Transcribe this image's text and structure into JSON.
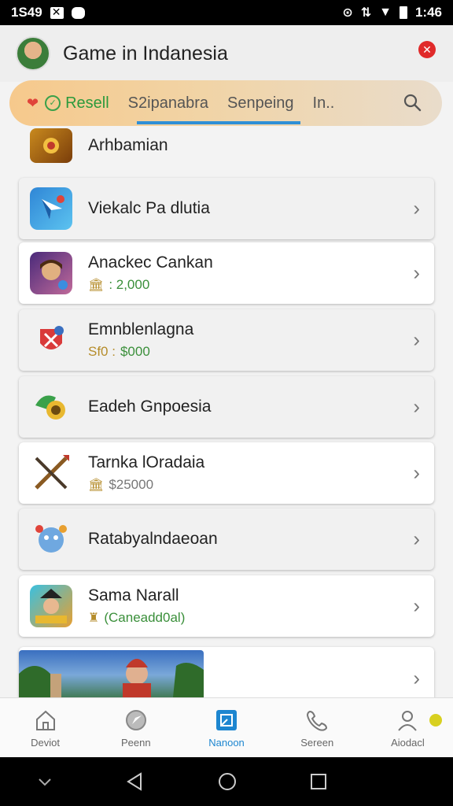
{
  "status_bar": {
    "time_left": "1S49",
    "time_right": "1:46"
  },
  "header": {
    "title": "Game in Indanesia"
  },
  "tabs": {
    "items": [
      {
        "label": "Resell"
      },
      {
        "label": "S2ipanabra"
      },
      {
        "label": "Senpeing"
      },
      {
        "label": "In.."
      }
    ],
    "active_index": 1
  },
  "list": {
    "items": [
      {
        "name": "Arhbamian",
        "sub": ""
      },
      {
        "name": "Viekalc Pa dlutia",
        "sub": ""
      },
      {
        "name": "Anackec Cankan",
        "sub": ": 2,000"
      },
      {
        "name": "Emnblenlagna",
        "sub_prefix": "Sf0 :",
        "sub": "$000"
      },
      {
        "name": "Eadeh Gnpoesia",
        "sub": ""
      },
      {
        "name": "Tarnka lOradaia",
        "sub": "$25000"
      },
      {
        "name": "Ratabyalndaeoan",
        "sub": ""
      },
      {
        "name": "Sama Narall",
        "sub": "(Caneadd0al)"
      }
    ]
  },
  "bottom_nav": {
    "items": [
      {
        "label": "Deviot"
      },
      {
        "label": "Peenn"
      },
      {
        "label": "Nanoon"
      },
      {
        "label": "Sereen"
      },
      {
        "label": "Aiodacl"
      }
    ],
    "active_index": 2
  },
  "colors": {
    "accent": "#1d86d0",
    "tab_active_underline": "#2e8fd6",
    "price_green": "#3a8f3a"
  }
}
